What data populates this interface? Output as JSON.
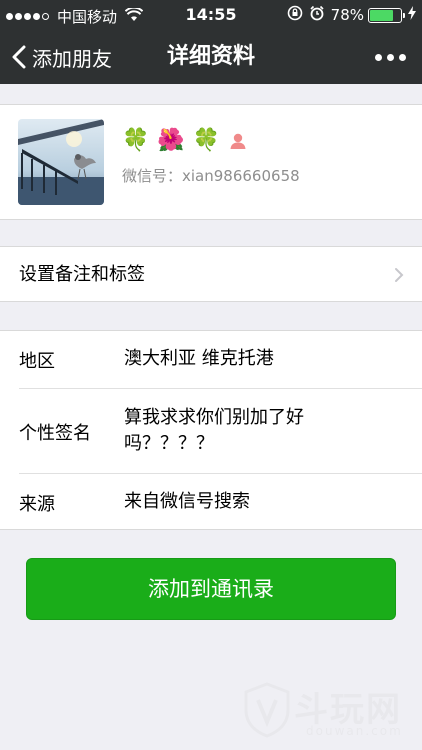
{
  "status_bar": {
    "carrier": "中国移动",
    "time": "14:55",
    "battery_percent": "78%",
    "battery_level": 0.78,
    "icons": [
      "signal-dots-icon",
      "wifi-icon",
      "rotation-lock-icon",
      "alarm-icon",
      "battery-icon",
      "charging-bolt-icon"
    ]
  },
  "nav": {
    "back_label": "添加朋友",
    "title": "详细资料",
    "more_icon": "more-dots-icon"
  },
  "profile": {
    "nickname_emojis": [
      "🍀",
      "🌺",
      "🍀"
    ],
    "gender_icon": "female-icon",
    "wechat_id_label": "微信号：",
    "wechat_id_value": "xian986660658"
  },
  "remark": {
    "label": "设置备注和标签"
  },
  "info": {
    "region_label": "地区",
    "region_value": "澳大利亚  维克托港",
    "signature_label": "个性签名",
    "signature_value": "算我求求你们别加了好吗？？？？",
    "source_label": "来源",
    "source_value": "来自微信号搜索"
  },
  "actions": {
    "add_button": "添加到通讯录"
  },
  "watermark": {
    "text": "斗玩网",
    "subtext": "douwan.com"
  },
  "colors": {
    "nav_bg": "#2e3132",
    "page_bg": "#efeff4",
    "primary_green": "#1aad19",
    "battery_green": "#4cd964",
    "female_pink": "#f08a8a"
  }
}
